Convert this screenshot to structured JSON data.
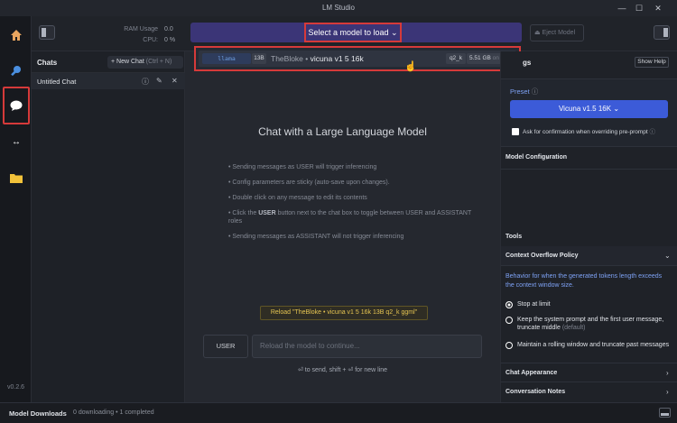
{
  "window": {
    "title": "LM Studio"
  },
  "rail": {
    "version": "v0.2.6"
  },
  "topbar": {
    "ram_label": "RAM Usage",
    "ram_value": "0.0",
    "cpu_label": "CPU:",
    "cpu_value": "0 %",
    "model_select_label": "Select a model to load",
    "eject_label": "Eject Model"
  },
  "model_dropdown": {
    "arch": "llama",
    "params": "13B",
    "publisher": "TheBloke",
    "separator": "•",
    "model_name": "vicuna v1 5 16k",
    "quant": "q2_k",
    "size": "5.51 GB",
    "disk_note": "on disk"
  },
  "chats": {
    "title": "Chats",
    "new_chat_label": "+ New Chat",
    "new_chat_shortcut": "(Ctrl + N)",
    "items": [
      {
        "label": "Untitled Chat"
      }
    ]
  },
  "main": {
    "heading": "Chat with a Large Language Model",
    "tips": [
      "• Sending messages as USER will trigger inferencing",
      "• Config parameters are sticky (auto-save upon changes).",
      "• Double click on any message to edit its contents",
      "• Sending messages as ASSISTANT will not trigger inferencing"
    ],
    "tip_toggle": {
      "prefix": "• Click the ",
      "strong": "USER",
      "suffix": " button next to the chat box to toggle between USER and ASSISTANT roles"
    },
    "reload_button": "Reload \"TheBloke • vicuna v1 5 16k 13B q2_k ggml\"",
    "role_button": "USER",
    "input_placeholder": "Reload the model to continue...",
    "send_hint": "⏎ to send, shift + ⏎ for new line"
  },
  "right_panel": {
    "header_title": "gs",
    "show_help": "Show Help",
    "preset_label": "Preset",
    "preset_value": "Vicuna v1.5 16K",
    "confirm_label": "Ask for confirmation when overriding pre-prompt",
    "model_config": "Model Configuration",
    "tools": "Tools",
    "context_overflow": "Context Overflow Policy",
    "overflow_desc": "Behavior for when the generated tokens length exceeds the context window size.",
    "opt_stop": "Stop at limit",
    "opt_keep": "Keep the system prompt and the first user message, truncate middle",
    "opt_keep_default": "(default)",
    "opt_rolling": "Maintain a rolling window and truncate past messages",
    "chat_appearance": "Chat Appearance",
    "conversation_notes": "Conversation Notes"
  },
  "statusbar": {
    "title": "Model Downloads",
    "status": "0 downloading • 1 completed"
  },
  "colors": {
    "accent_select": "#3b3577",
    "preset_blue": "#3c5bd8",
    "highlight_red": "#d63a3a",
    "reload_yellow": "#e6c552"
  }
}
